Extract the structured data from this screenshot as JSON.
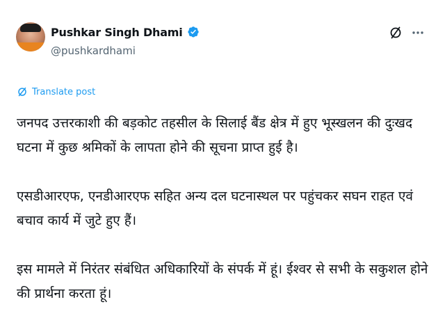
{
  "author": {
    "display_name": "Pushkar Singh Dhami",
    "handle": "@pushkardhami",
    "verified": true
  },
  "actions": {
    "grok_icon": "grok-icon",
    "more_icon": "more-icon"
  },
  "translate": {
    "label": "Translate post",
    "icon": "translate-icon"
  },
  "post": {
    "paragraphs": [
      "जनपद उत्तरकाशी की बड़कोट तहसील के सिलाई बैंड क्षेत्र में हुए भूस्खलन की दुःखद घटना में कुछ श्रमिकों के लापता होने की सूचना प्राप्त हुई है।",
      "एसडीआरएफ, एनडीआरएफ सहित अन्य दल घटनास्थल पर पहुंचकर सघन राहत एवं बचाव कार्य में जुटे हुए हैं।",
      "इस मामले में निरंतर संबंधित अधिकारियों के संपर्क में हूं। ईश्वर से सभी के सकुशल होने की प्रार्थना करता हूं।"
    ]
  },
  "colors": {
    "text": "#0f1419",
    "secondary": "#536471",
    "accent": "#1d9bf0"
  }
}
